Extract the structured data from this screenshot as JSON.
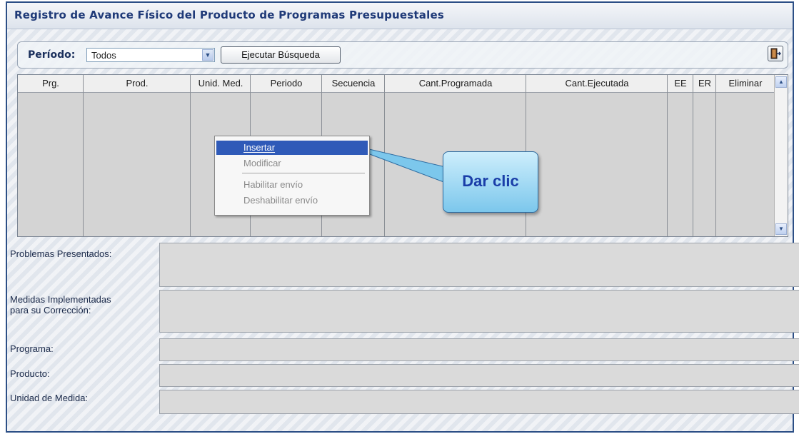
{
  "window": {
    "title": "Registro de Avance Físico del Producto de Programas Presupuestales"
  },
  "toolbar": {
    "periodo_label": "Período:",
    "periodo_value": "Todos",
    "search_button": "Ejecutar Búsqueda",
    "exit_icon": "exit-door-icon"
  },
  "grid": {
    "columns": [
      "Prg.",
      "Prod.",
      "Unid. Med.",
      "Periodo",
      "Secuencia",
      "Cant.Programada",
      "Cant.Ejecutada",
      "EE",
      "ER",
      "Eliminar"
    ]
  },
  "context_menu": {
    "items": [
      "Insertar",
      "Modificar",
      "Habilitar envío",
      "Deshabilitar envío"
    ]
  },
  "callout": {
    "text": "Dar clic"
  },
  "fields": {
    "problemas": "Problemas Presentados:",
    "medidas_1": "Medidas Implementadas",
    "medidas_2": "para su Corrección:",
    "programa": "Programa:",
    "producto": "Producto:",
    "unidad": "Unidad de Medida:"
  },
  "colors": {
    "title": "#1f3a78",
    "menu_highlight": "#2f5ab8",
    "callout_text": "#1a3ea8"
  }
}
